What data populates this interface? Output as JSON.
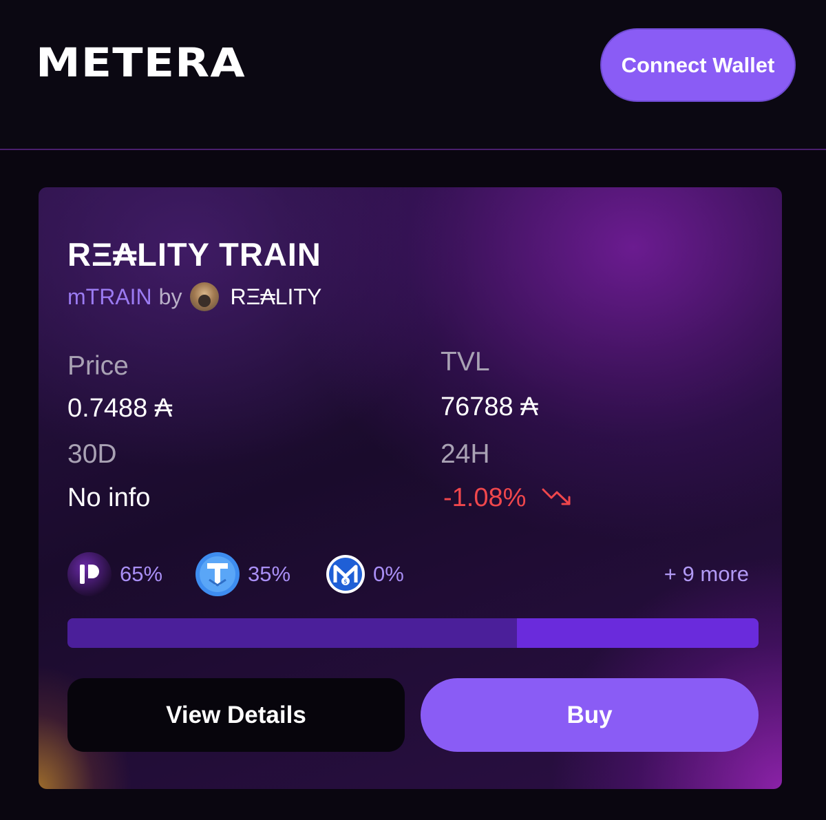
{
  "header": {
    "logo_text": "METERA",
    "connect_button_label": "Connect Wallet"
  },
  "card": {
    "title": "RΞ₳LITY TRAIN",
    "token_symbol": "mTRAIN",
    "by_text": "by",
    "creator_name": "RΞ₳LITY",
    "stats": {
      "price_label": "Price",
      "price_value": "0.7488 ₳",
      "tvl_label": "TVL",
      "tvl_value": "76788 ₳",
      "d30_label": "30D",
      "d30_value": "No info",
      "h24_label": "24H",
      "h24_value": "-1.08%"
    },
    "assets": [
      {
        "icon": "purple-token-icon",
        "pct": "65%",
        "share": 65
      },
      {
        "icon": "tether-token-icon",
        "pct": "35%",
        "share": 35
      },
      {
        "icon": "m-dollar-token-icon",
        "pct": "0%",
        "share": 0
      }
    ],
    "more_label": "+ 9 more",
    "view_details_label": "View Details",
    "buy_label": "Buy"
  },
  "colors": {
    "accent": "#8a5cf5",
    "negative": "#f0474c",
    "background": "#0a0610"
  }
}
